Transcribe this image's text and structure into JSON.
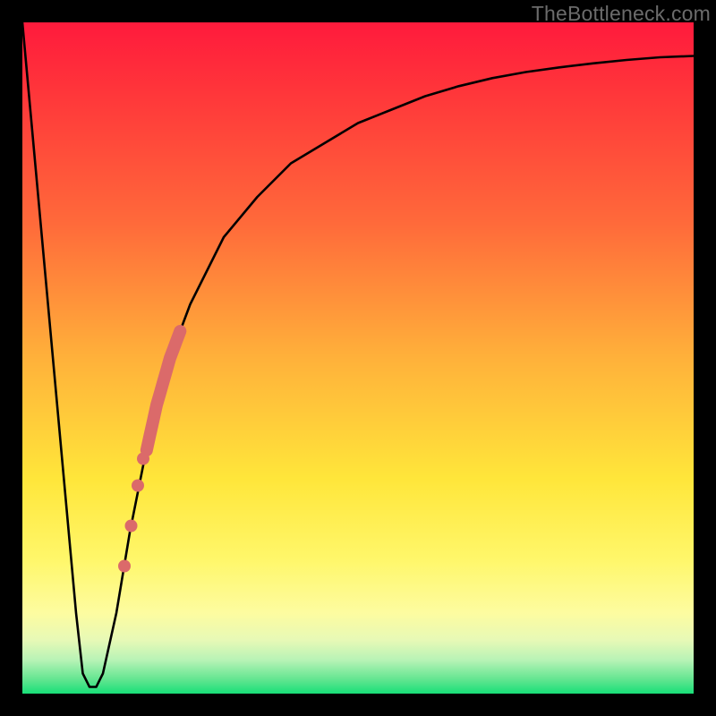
{
  "watermark": "TheBottleneck.com",
  "chart_data": {
    "type": "line",
    "title": "",
    "xlabel": "",
    "ylabel": "",
    "xlim": [
      0,
      100
    ],
    "ylim": [
      0,
      100
    ],
    "series": [
      {
        "name": "bottleneck-curve",
        "x": [
          0,
          2,
          4,
          6,
          8,
          9,
          10,
          11,
          12,
          14,
          16,
          18,
          20,
          22,
          25,
          30,
          35,
          40,
          45,
          50,
          55,
          60,
          65,
          70,
          75,
          80,
          85,
          90,
          95,
          100
        ],
        "y": [
          100,
          78,
          56,
          34,
          12,
          3,
          1,
          1,
          3,
          12,
          24,
          34,
          43,
          50,
          58,
          68,
          74,
          79,
          82,
          85,
          87,
          89,
          90.5,
          91.7,
          92.6,
          93.3,
          93.9,
          94.4,
          94.8,
          95
        ]
      }
    ],
    "markers": [
      {
        "name": "dot-1",
        "x": 15.2,
        "y": 19
      },
      {
        "name": "dot-2",
        "x": 16.2,
        "y": 25
      },
      {
        "name": "dot-3",
        "x": 17.2,
        "y": 31
      },
      {
        "name": "dot-4",
        "x": 18.0,
        "y": 35
      }
    ],
    "thick_segment": {
      "x_start": 18.5,
      "x_end": 23.5,
      "y_start": 37,
      "y_end": 54
    },
    "colors": {
      "curve": "#000000",
      "marker": "#db6a6a",
      "gradient_top": "#ff1a3c",
      "gradient_bottom": "#18df78"
    }
  }
}
